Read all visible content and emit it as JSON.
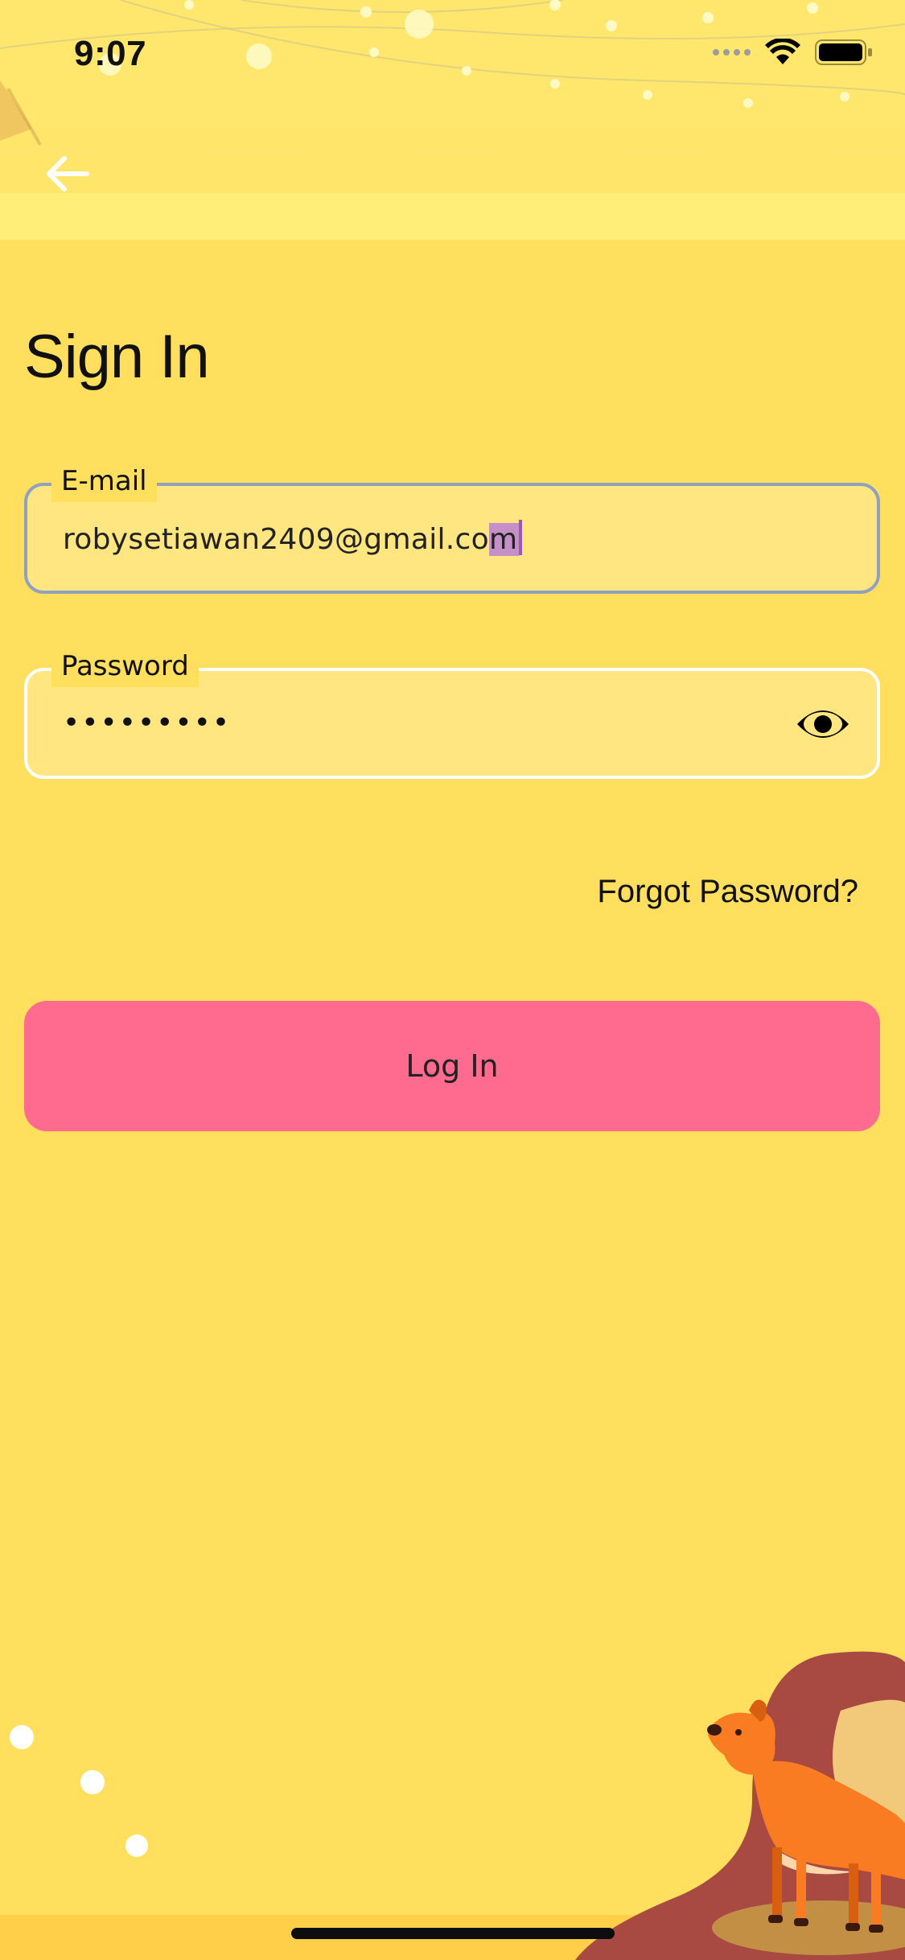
{
  "status_bar": {
    "time": "9:07"
  },
  "page": {
    "title": "Sign In"
  },
  "form": {
    "email": {
      "label": "E-mail",
      "value": "robysetiawan2409@gmail.co",
      "selected_part": "m"
    },
    "password": {
      "label": "Password",
      "masked_value": "•••••••••"
    },
    "forgot_label": "Forgot Password?",
    "login_label": "Log In"
  },
  "colors": {
    "background": "#FFDF5D",
    "button": "#FF6B8E",
    "email_border_focused": "#8FA1BE",
    "field_fill": "#FFE681"
  },
  "icons": {
    "back": "arrow-left-icon",
    "visibility": "eye-icon"
  }
}
